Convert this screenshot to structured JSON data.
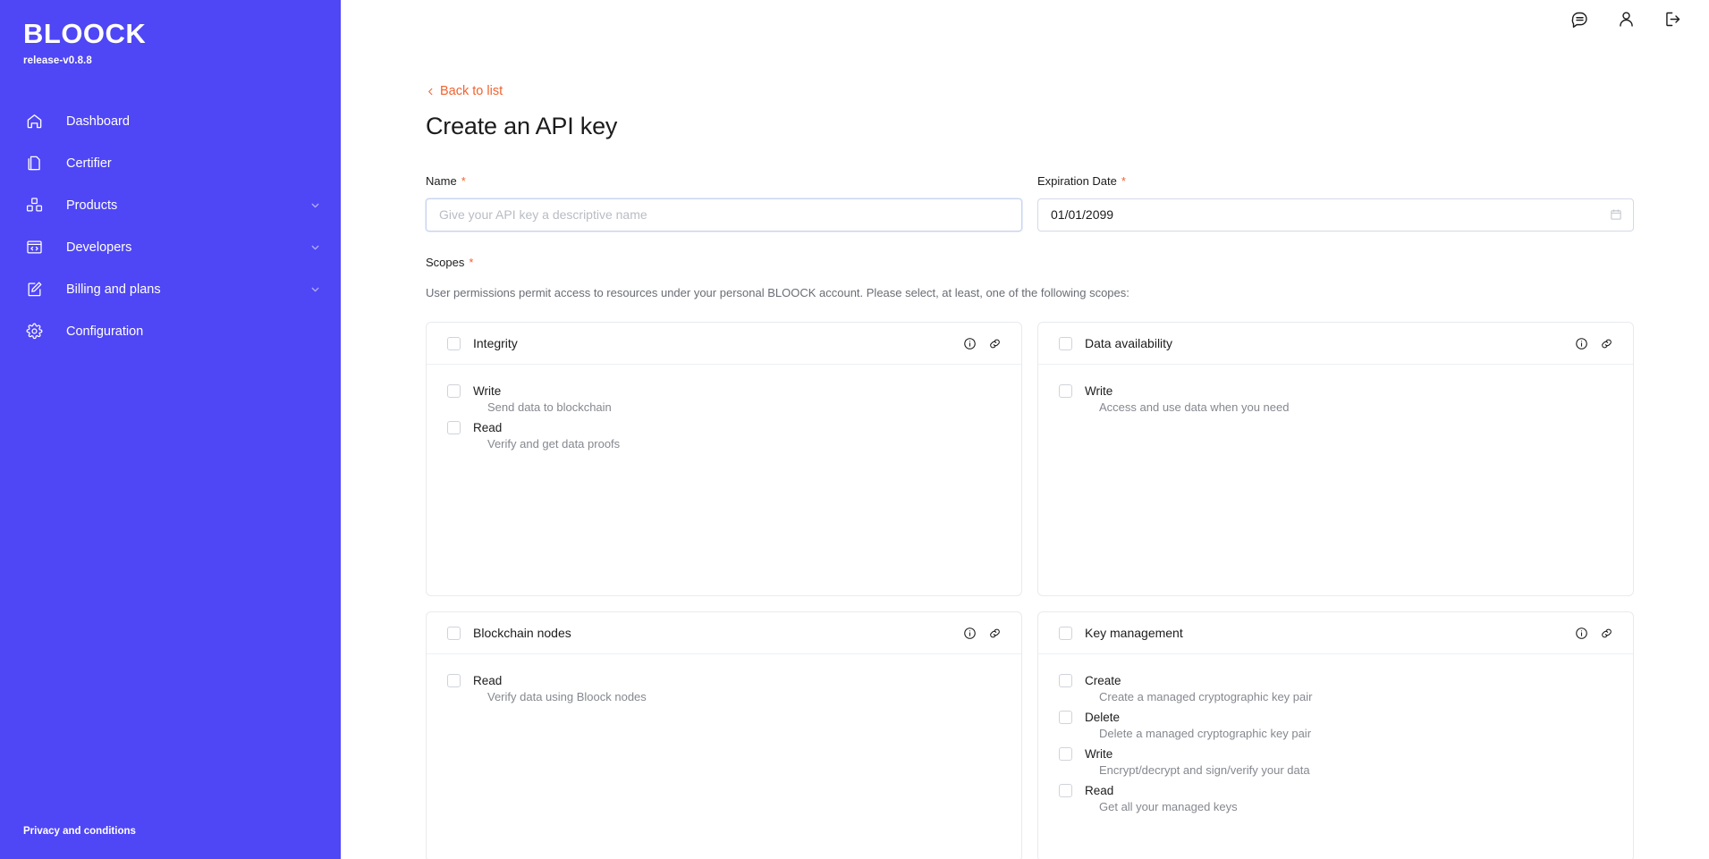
{
  "sidebar": {
    "brand": "BLOOCK",
    "version": "release-v0.8.8",
    "items": [
      {
        "label": "Dashboard",
        "icon": "home-icon",
        "expandable": false
      },
      {
        "label": "Certifier",
        "icon": "document-icon",
        "expandable": false
      },
      {
        "label": "Products",
        "icon": "boxes-icon",
        "expandable": true
      },
      {
        "label": "Developers",
        "icon": "code-icon",
        "expandable": true
      },
      {
        "label": "Billing and plans",
        "icon": "edit-icon",
        "expandable": true
      },
      {
        "label": "Configuration",
        "icon": "gear-icon",
        "expandable": false
      }
    ],
    "footer_link": "Privacy and conditions",
    "bg_color": "#4F46F5"
  },
  "topbar": {
    "actions": [
      {
        "name": "chat-icon",
        "title": "Messages"
      },
      {
        "name": "user-icon",
        "title": "Account"
      },
      {
        "name": "logout-icon",
        "title": "Log out"
      }
    ]
  },
  "page": {
    "back_link": "Back to list",
    "title": "Create an API key",
    "accent_color": "#F2632F"
  },
  "form": {
    "name": {
      "label": "Name",
      "required": true,
      "value": "",
      "placeholder": "Give your API key a descriptive name",
      "focused": true
    },
    "expiration": {
      "label": "Expiration Date",
      "required": true,
      "value": "01/01/2099",
      "placeholder": "",
      "icon": "calendar-icon"
    }
  },
  "scopes": {
    "label": "Scopes",
    "required": true,
    "description": "User permissions permit access to resources under your personal BLOOCK account. Please select, at least, one of the following scopes:",
    "cards": [
      {
        "title": "Integrity",
        "checked": false,
        "actions": [
          "info-icon",
          "link-icon"
        ],
        "permissions": [
          {
            "label": "Write",
            "description": "Send data to blockchain",
            "checked": false
          },
          {
            "label": "Read",
            "description": "Verify and get data proofs",
            "checked": false
          }
        ]
      },
      {
        "title": "Data availability",
        "checked": false,
        "actions": [
          "info-icon",
          "link-icon"
        ],
        "permissions": [
          {
            "label": "Write",
            "description": "Access and use data when you need",
            "checked": false
          }
        ]
      },
      {
        "title": "Blockchain nodes",
        "checked": false,
        "actions": [
          "info-icon",
          "link-icon"
        ],
        "permissions": [
          {
            "label": "Read",
            "description": "Verify data using Bloock nodes",
            "checked": false
          }
        ]
      },
      {
        "title": "Key management",
        "checked": false,
        "actions": [
          "info-icon",
          "link-icon"
        ],
        "permissions": [
          {
            "label": "Create",
            "description": "Create a managed cryptographic key pair",
            "checked": false
          },
          {
            "label": "Delete",
            "description": "Delete a managed cryptographic key pair",
            "checked": false
          },
          {
            "label": "Write",
            "description": "Encrypt/decrypt and sign/verify your data",
            "checked": false
          },
          {
            "label": "Read",
            "description": "Get all your managed keys",
            "checked": false
          }
        ]
      }
    ]
  }
}
